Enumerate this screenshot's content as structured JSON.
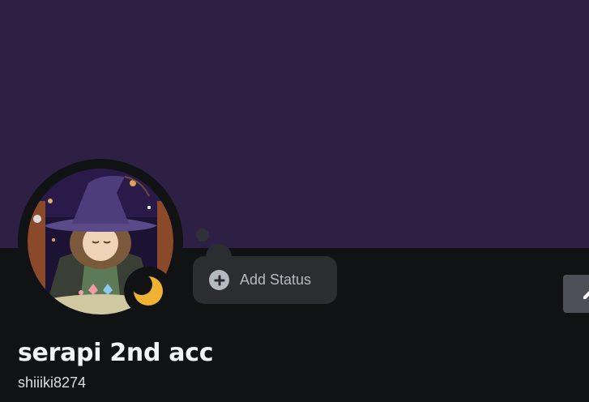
{
  "profile": {
    "display_name": "serapi 2nd acc",
    "username": "shiiiki8274",
    "status_icon": "crescent-moon-icon",
    "status_color": "#f0b232"
  },
  "status_bubble": {
    "label": "Add Status",
    "icon": "plus-circle-icon"
  },
  "colors": {
    "banner": "#2e1f44",
    "background": "#111214",
    "bubble": "#2b2d31",
    "button": "#4e5058"
  },
  "edit_button": {
    "icon": "pencil-icon"
  }
}
